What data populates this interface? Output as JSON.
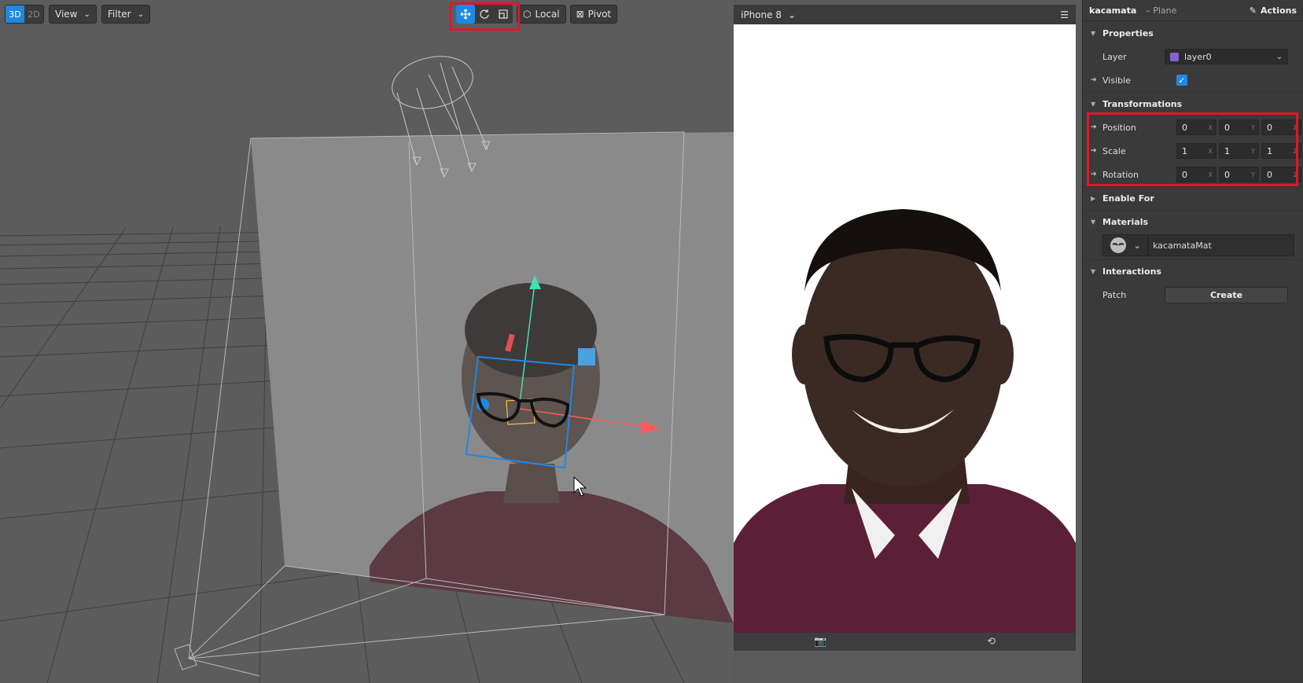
{
  "viewport": {
    "mode_3d": "3D",
    "mode_2d": "2D",
    "view_label": "View",
    "filter_label": "Filter",
    "local_label": "Local",
    "pivot_label": "Pivot",
    "tools": [
      "move-icon",
      "rotate-icon",
      "scale-icon"
    ]
  },
  "preview": {
    "device": "iPhone 8"
  },
  "inspector": {
    "object_name": "kacamata",
    "object_type": "– Plane",
    "actions_label": "Actions",
    "properties": {
      "title": "Properties",
      "layer_label": "Layer",
      "layer_value": "layer0",
      "layer_color": "#8a63d2",
      "visible_label": "Visible",
      "visible": true
    },
    "transformations": {
      "title": "Transformations",
      "axis_x": "X",
      "axis_y": "Y",
      "axis_z": "Z",
      "position": {
        "label": "Position",
        "x": "0",
        "y": "0",
        "z": "0"
      },
      "scale": {
        "label": "Scale",
        "x": "1",
        "y": "1",
        "z": "1"
      },
      "rotation": {
        "label": "Rotation",
        "x": "0",
        "y": "0",
        "z": "0"
      }
    },
    "enable_for": {
      "title": "Enable For"
    },
    "materials": {
      "title": "Materials",
      "material_name": "kacamataMat"
    },
    "interactions": {
      "title": "Interactions",
      "patch_label": "Patch",
      "create_label": "Create"
    }
  },
  "colors": {
    "accent": "#1e88e5",
    "highlight": "#e0162b"
  }
}
